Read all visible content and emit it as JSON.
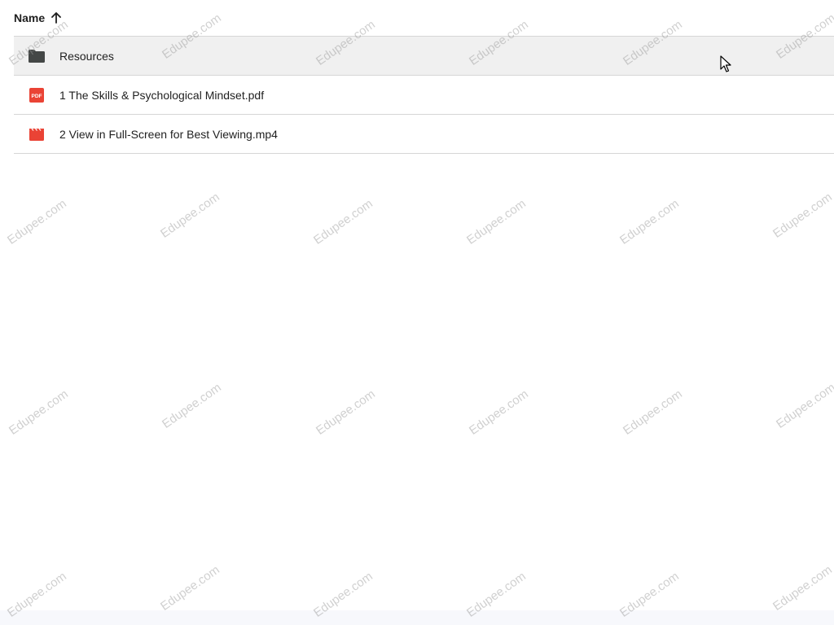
{
  "header": {
    "name_label": "Name",
    "sort_icon": "arrow-up-icon"
  },
  "files": [
    {
      "name": "Resources",
      "icon": "folder-icon",
      "type": "folder",
      "hovered": true
    },
    {
      "name": "1 The Skills & Psychological Mindset.pdf",
      "icon": "pdf-icon",
      "type": "pdf",
      "hovered": false
    },
    {
      "name": "2 View in Full-Screen for Best Viewing.mp4",
      "icon": "video-icon",
      "type": "video",
      "hovered": false
    }
  ],
  "watermark": {
    "text": "Edupee.com"
  },
  "colors": {
    "hover_row": "#f0f0f0",
    "divider": "#d6d6d6",
    "folder": "#444746",
    "pdf_red": "#ea4335",
    "video_red": "#ea4335"
  }
}
